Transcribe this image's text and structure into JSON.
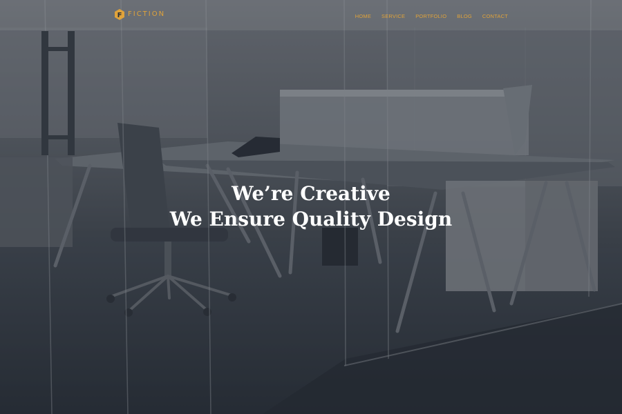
{
  "brand": {
    "logo_letter": "F",
    "name": "FICTION",
    "accent_color": "#e0a33a"
  },
  "nav": {
    "items": [
      {
        "label": "HOME"
      },
      {
        "label": "SERVICE"
      },
      {
        "label": "PORTFOLIO"
      },
      {
        "label": "BLOG"
      },
      {
        "label": "CONTACT"
      }
    ]
  },
  "hero": {
    "line1": "We’re Creative",
    "line2": "We Ensure Quality Design",
    "background": "office-photo-dark-overlay"
  }
}
